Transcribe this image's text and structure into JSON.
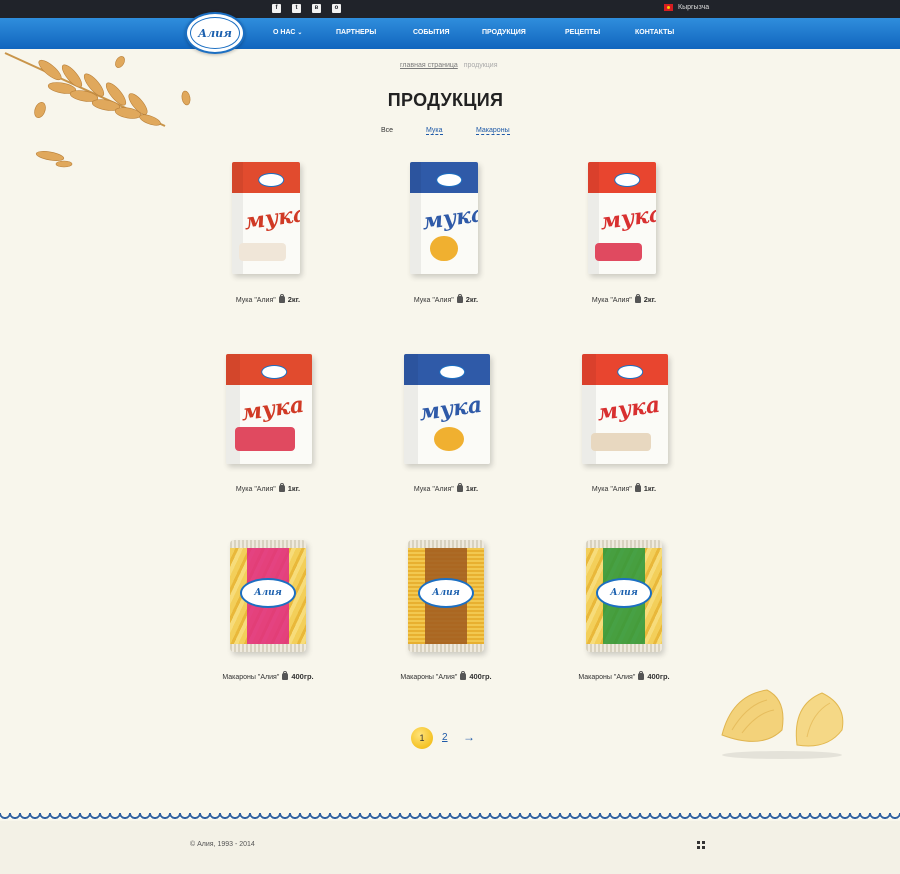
{
  "topbar": {
    "social": [
      {
        "icon": "facebook-icon",
        "glyph": "f"
      },
      {
        "icon": "twitter-icon",
        "glyph": "t"
      },
      {
        "icon": "vk-icon",
        "glyph": "в"
      },
      {
        "icon": "odnoklassniki-icon",
        "glyph": "о"
      }
    ],
    "language": "Кыргызча"
  },
  "logo": {
    "text": "Алия"
  },
  "nav": {
    "about": "О НАС",
    "partners": "ПАРТНЕРЫ",
    "events": "СОБЫТИЯ",
    "products": "ПРОДУКЦИЯ",
    "recipes": "РЕЦЕПТЫ",
    "contacts": "КОНТАКТЫ"
  },
  "breadcrumb": {
    "home": "главная страница",
    "current": "продукция"
  },
  "page_title": "ПРОДУКЦИЯ",
  "filters": {
    "all": "Все",
    "flour": "Мука",
    "pasta": "Макароны"
  },
  "products": [
    {
      "name": "Мука \"Алия\"",
      "weight": "2кг."
    },
    {
      "name": "Мука \"Алия\"",
      "weight": "2кг."
    },
    {
      "name": "Мука \"Алия\"",
      "weight": "2кг."
    },
    {
      "name": "Мука \"Алия\"",
      "weight": "1кг."
    },
    {
      "name": "Мука \"Алия\"",
      "weight": "1кг."
    },
    {
      "name": "Мука \"Алия\"",
      "weight": "1кг."
    },
    {
      "name": "Макароны \"Алия\"",
      "weight": "400гр."
    },
    {
      "name": "Макароны \"Алия\"",
      "weight": "400гр."
    },
    {
      "name": "Макароны \"Алия\"",
      "weight": "400гр."
    }
  ],
  "pagination": {
    "current": "1",
    "next_page": "2",
    "next_arrow": "→"
  },
  "footer": {
    "copyright": "© Алия, 1993 - 2014"
  },
  "colors": {
    "accent": "#1f5aa8",
    "nav_blue": "#1165be",
    "background": "#f8f6ec"
  }
}
